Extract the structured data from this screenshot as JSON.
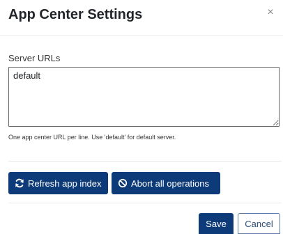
{
  "dialog": {
    "title": "App Center Settings",
    "close_glyph": "×",
    "server_urls": {
      "label": "Server URLs",
      "value": "default",
      "help": "One app center URL per line. Use 'default' for default server."
    },
    "actions": {
      "refresh_label": "Refresh app index",
      "refresh_icon": "refresh-icon",
      "abort_label": "Abort all operations",
      "abort_icon": "ban-icon"
    },
    "footer": {
      "save_label": "Save",
      "cancel_label": "Cancel"
    }
  },
  "colors": {
    "primary": "#0d3b7a",
    "divider": "#e9ecef",
    "text": "#212529"
  }
}
